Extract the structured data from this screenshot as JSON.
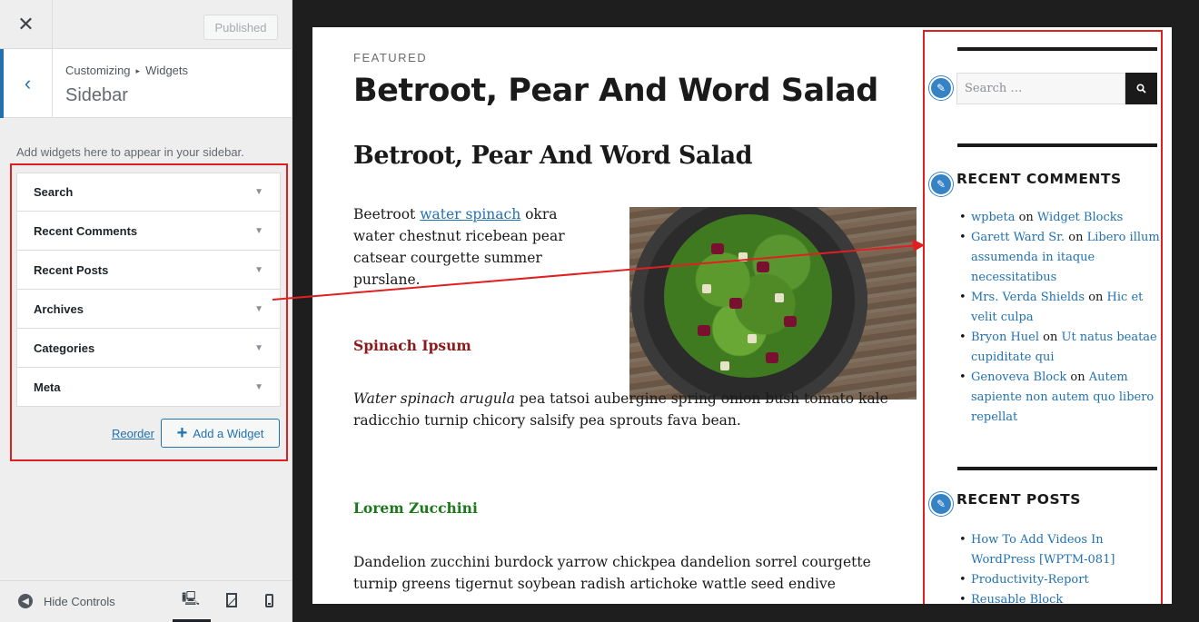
{
  "panel": {
    "close_icon": "close-icon",
    "published_label": "Published",
    "breadcrumb_parent": "Customizing",
    "breadcrumb_sep": "▸",
    "breadcrumb_child": "Widgets",
    "section_title": "Sidebar",
    "description": "Add widgets here to appear in your sidebar.",
    "widgets": [
      {
        "label": "Search"
      },
      {
        "label": "Recent Comments"
      },
      {
        "label": "Recent Posts"
      },
      {
        "label": "Archives"
      },
      {
        "label": "Categories"
      },
      {
        "label": "Meta"
      }
    ],
    "reorder_label": "Reorder",
    "add_widget_label": "Add a Widget",
    "hide_controls_label": "Hide Controls"
  },
  "preview": {
    "featured_label": "FEATURED",
    "post_title": "Betroot, Pear And Word Salad",
    "post_heading": "Betroot, Pear And Word Salad",
    "para1_before": "Beetroot ",
    "para1_link": "water spinach",
    "para1_after": " okra water chestnut ricebean pear catsear courgette summer purslane.",
    "spinach_heading": "Spinach Ipsum",
    "para2_em": "Water spinach arugula",
    "para2_rest": " pea tatsoi aubergine spring onion bush tomato kale radicchio turnip chicory salsify pea sprouts fava bean.",
    "zucchini_heading": "Lorem Zucchini",
    "para3": "Dandelion zucchini burdock yarrow chickpea dandelion sorrel courgette turnip greens tigernut soybean radish artichoke wattle seed endive",
    "search_placeholder": "Search …",
    "recent_comments_title": "RECENT COMMENTS",
    "comments": [
      {
        "author": "wpbeta",
        "on": " on ",
        "post": "Widget Blocks"
      },
      {
        "author": "Garett Ward Sr.",
        "on": " on ",
        "post": "Libero illum assumenda in itaque necessitatibus"
      },
      {
        "author": "Mrs. Verda Shields",
        "on": " on ",
        "post": "Hic et velit culpa"
      },
      {
        "author": "Bryon Huel",
        "on": " on ",
        "post": "Ut natus beatae cupiditate qui"
      },
      {
        "author": "Genoveva Block",
        "on": " on ",
        "post": "Autem sapiente non autem quo libero repellat"
      }
    ],
    "recent_posts_title": "RECENT POSTS",
    "posts": [
      {
        "title": "How To Add Videos In WordPress [WPTM-081]"
      },
      {
        "title": "Productivity-Report"
      },
      {
        "title": "Reusable Block"
      }
    ]
  },
  "colors": {
    "accent": "#2271b1",
    "annotation_red": "#e02020",
    "spinach_heading": "#8b1a1a",
    "zucchini_heading": "#1a7a1a"
  }
}
